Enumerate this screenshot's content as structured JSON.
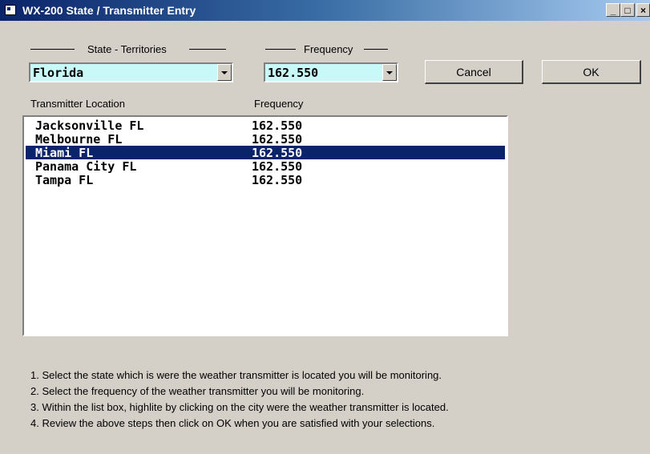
{
  "window": {
    "title": "WX-200 State / Transmitter Entry",
    "minimize_label": "_",
    "maximize_label": "□",
    "close_label": "×"
  },
  "state_group": {
    "label": "State - Territories",
    "selected": "Florida"
  },
  "frequency_group": {
    "label": "Frequency",
    "selected": "162.550"
  },
  "buttons": {
    "cancel": "Cancel",
    "ok": "OK"
  },
  "list": {
    "headers": {
      "location": "Transmitter Location",
      "frequency": "Frequency"
    },
    "rows": [
      {
        "city": "Jacksonville FL",
        "freq": "162.550"
      },
      {
        "city": "Melbourne FL",
        "freq": "162.550"
      },
      {
        "city": "Miami FL",
        "freq": "162.550"
      },
      {
        "city": "Panama City FL",
        "freq": "162.550"
      },
      {
        "city": "Tampa FL",
        "freq": "162.550"
      }
    ],
    "selected_index": 2
  },
  "instructions": [
    "1.  Select the state which is were the weather transmitter is located you will be monitoring.",
    "2.  Select the frequency of the weather transmitter you will be monitoring.",
    "3.  Within the list box, highlite by clicking on the city were the weather transmitter is located.",
    "4.  Review the above steps then click on OK when you are satisfied with your selections."
  ]
}
